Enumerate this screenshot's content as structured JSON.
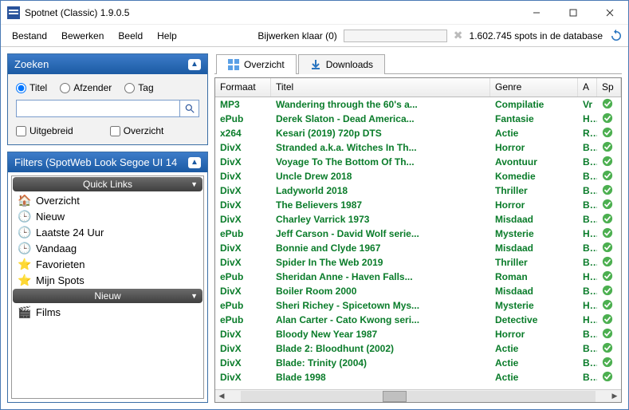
{
  "window": {
    "title": "Spotnet (Classic) 1.9.0.5"
  },
  "menu": {
    "items": [
      "Bestand",
      "Bewerken",
      "Beeld",
      "Help"
    ]
  },
  "status": {
    "update_text": "Bijwerken klaar (0)",
    "db_text": "1.602.745 spots in de database"
  },
  "search_panel": {
    "header": "Zoeken",
    "radios": {
      "titel": "Titel",
      "afzender": "Afzender",
      "tag": "Tag"
    },
    "value": "",
    "uitgebreid": "Uitgebreid",
    "overzicht": "Overzicht"
  },
  "filters_panel": {
    "header": "Filters (SpotWeb Look Segoe UI 14",
    "quick_links_hdr": "Quick Links",
    "nieuw_hdr": "Nieuw",
    "items": [
      {
        "icon": "🏠",
        "label": "Overzicht"
      },
      {
        "icon": "🕒",
        "label": "Nieuw"
      },
      {
        "icon": "🕒",
        "label": "Laatste 24 Uur"
      },
      {
        "icon": "🕒",
        "label": "Vandaag"
      },
      {
        "icon": "⭐",
        "label": "Favorieten"
      },
      {
        "icon": "⭐",
        "label": "Mijn Spots"
      }
    ],
    "nieuw_items": [
      {
        "icon": "🎬",
        "label": "Films"
      }
    ]
  },
  "tabs": {
    "overzicht": "Overzicht",
    "downloads": "Downloads"
  },
  "grid": {
    "headers": {
      "format": "Formaat",
      "title": "Titel",
      "genre": "Genre",
      "a": "A",
      "sp": "Sp"
    },
    "rows": [
      {
        "format": "MP3",
        "title": "Wandering through the 60's a...",
        "genre": "Compilatie",
        "a": "Vr"
      },
      {
        "format": "ePub",
        "title": "Derek Slaton - Dead America...",
        "genre": "Fantasie",
        "a": "Ho"
      },
      {
        "format": "x264",
        "title": "Kesari (2019) 720p DTS",
        "genre": "Actie",
        "a": "Ro"
      },
      {
        "format": "DivX",
        "title": "Stranded a.k.a. Witches In Th...",
        "genre": "Horror",
        "a": "Bo"
      },
      {
        "format": "DivX",
        "title": "Voyage To The Bottom Of Th...",
        "genre": "Avontuur",
        "a": "Bo"
      },
      {
        "format": "DivX",
        "title": "Uncle Drew 2018",
        "genre": "Komedie",
        "a": "Bo"
      },
      {
        "format": "DivX",
        "title": "Ladyworld 2018",
        "genre": "Thriller",
        "a": "Bo"
      },
      {
        "format": "DivX",
        "title": "The Believers 1987",
        "genre": "Horror",
        "a": "Bo"
      },
      {
        "format": "DivX",
        "title": "Charley Varrick 1973",
        "genre": "Misdaad",
        "a": "Bo"
      },
      {
        "format": "ePub",
        "title": "Jeff Carson - David Wolf serie...",
        "genre": "Mysterie",
        "a": "Ho"
      },
      {
        "format": "DivX",
        "title": "Bonnie and Clyde 1967",
        "genre": "Misdaad",
        "a": "Bo"
      },
      {
        "format": "DivX",
        "title": "Spider In The Web 2019",
        "genre": "Thriller",
        "a": "Bo"
      },
      {
        "format": "ePub",
        "title": "Sheridan Anne - Haven Falls...",
        "genre": "Roman",
        "a": "Ho"
      },
      {
        "format": "DivX",
        "title": "Boiler Room 2000",
        "genre": "Misdaad",
        "a": "Bo"
      },
      {
        "format": "ePub",
        "title": "Sheri Richey - Spicetown Mys...",
        "genre": "Mysterie",
        "a": "Ho"
      },
      {
        "format": "ePub",
        "title": "Alan Carter - Cato Kwong seri...",
        "genre": "Detective",
        "a": "Ho"
      },
      {
        "format": "DivX",
        "title": "Bloody New Year 1987",
        "genre": "Horror",
        "a": "Bo"
      },
      {
        "format": "DivX",
        "title": "Blade 2: Bloodhunt (2002)",
        "genre": "Actie",
        "a": "Bo"
      },
      {
        "format": "DivX",
        "title": "Blade: Trinity (2004)",
        "genre": "Actie",
        "a": "Bo"
      },
      {
        "format": "DivX",
        "title": "Blade 1998",
        "genre": "Actie",
        "a": "Bo"
      }
    ]
  }
}
